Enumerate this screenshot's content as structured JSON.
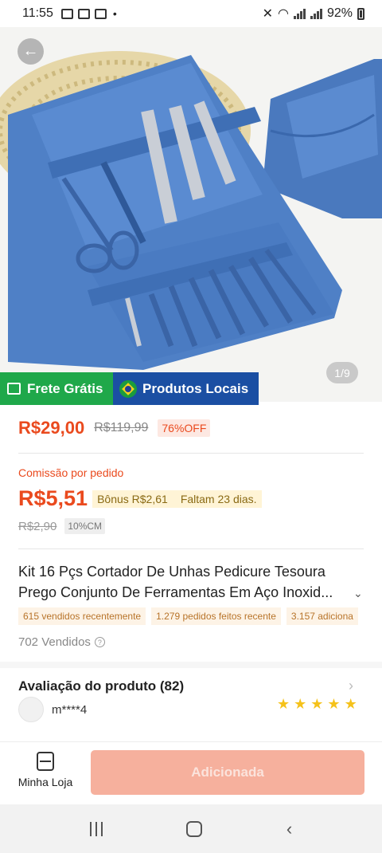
{
  "status_bar": {
    "time": "11:55",
    "battery": "92%"
  },
  "hero": {
    "page_indicator": "1/9"
  },
  "banner": {
    "free_shipping": "Frete Grátis",
    "local_products": "Produtos Locais"
  },
  "pricing": {
    "price": "R$29,00",
    "original_price": "R$119,99",
    "discount": "76%OFF"
  },
  "commission": {
    "label": "Comissão por pedido",
    "value": "R$5,51",
    "bonus": "Bônus R$2,61",
    "remaining": "Faltam 23 dias.",
    "old_value": "R$2,90",
    "rate": "10%CM"
  },
  "product": {
    "title_line1": "Kit 16 Pçs Cortador De Unhas Pedicure Tesoura",
    "title_line2": "Prego Conjunto De Ferramentas Em Aço Inoxid...",
    "tags": [
      "615 vendidos recentemente",
      "1.279 pedidos feitos recente",
      "3.157 adiciona"
    ],
    "sold": "702 Vendidos"
  },
  "reviews": {
    "title": "Avaliação do produto (82)",
    "reviewer": "m****4",
    "rating": 5
  },
  "actions": {
    "store_label": "Minha Loja",
    "add_label": "Adicionada"
  },
  "colors": {
    "accent": "#ea4a1e",
    "free_shipping_green": "#1fa84a",
    "local_blue": "#1b4fa3",
    "add_button": "#f6b09d"
  }
}
